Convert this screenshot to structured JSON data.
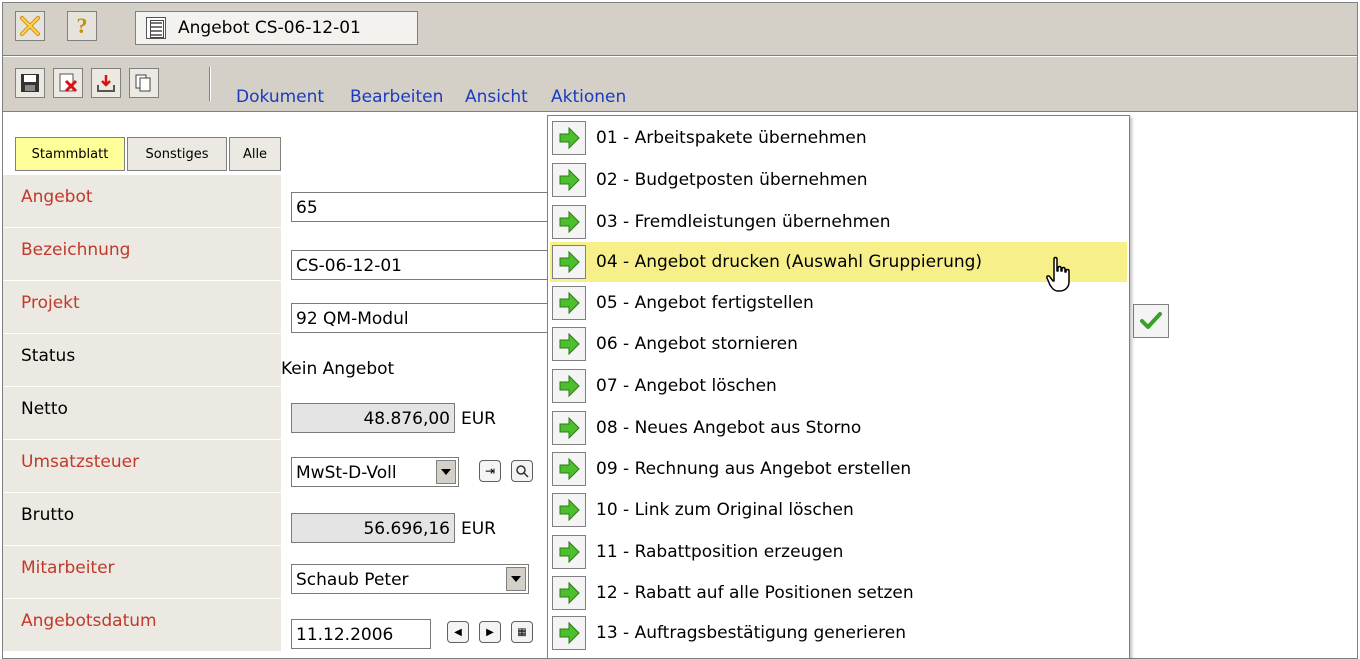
{
  "window": {
    "tab_title": "Angebot CS-06-12-01"
  },
  "toolbar": {
    "menus": [
      "Dokument",
      "Bearbeiten",
      "Ansicht",
      "Aktionen"
    ]
  },
  "tabs": [
    "Stammblatt",
    "Sonstiges",
    "Alle"
  ],
  "form": {
    "angebot": {
      "label": "Angebot",
      "value": "65"
    },
    "bezeichnung": {
      "label": "Bezeichnung",
      "value": "CS-06-12-01"
    },
    "projekt": {
      "label": "Projekt",
      "value": "92 QM-Modul"
    },
    "status": {
      "label": "Status",
      "value": "Kein Angebot"
    },
    "netto": {
      "label": "Netto",
      "value": "48.876,00",
      "unit": "EUR"
    },
    "umsatzsteuer": {
      "label": "Umsatzsteuer",
      "value": "MwSt-D-Voll"
    },
    "brutto": {
      "label": "Brutto",
      "value": "56.696,16",
      "unit": "EUR"
    },
    "mitarbeiter": {
      "label": "Mitarbeiter",
      "value": "Schaub Peter"
    },
    "angebotsdatum": {
      "label": "Angebotsdatum",
      "value": "11.12.2006"
    }
  },
  "actions_menu": {
    "highlighted_index": 3,
    "items": [
      "01 - Arbeitspakete übernehmen",
      "02 - Budgetposten übernehmen",
      "03 - Fremdleistungen übernehmen",
      "04 - Angebot drucken (Auswahl Gruppierung)",
      "05 - Angebot fertigstellen",
      "06 - Angebot stornieren",
      "07 - Angebot löschen",
      "08 - Neues Angebot aus Storno",
      "09 - Rechnung aus Angebot erstellen",
      "10 - Link zum Original löschen",
      "11 - Rabattposition erzeugen",
      "12 - Rabatt auf alle Positionen setzen",
      "13 - Auftragsbestätigung generieren"
    ]
  },
  "colors": {
    "required_label": "#c0392b",
    "menu_link": "#1a3bbf",
    "highlight": "#f7f08a",
    "active_tab": "#ffff99"
  }
}
